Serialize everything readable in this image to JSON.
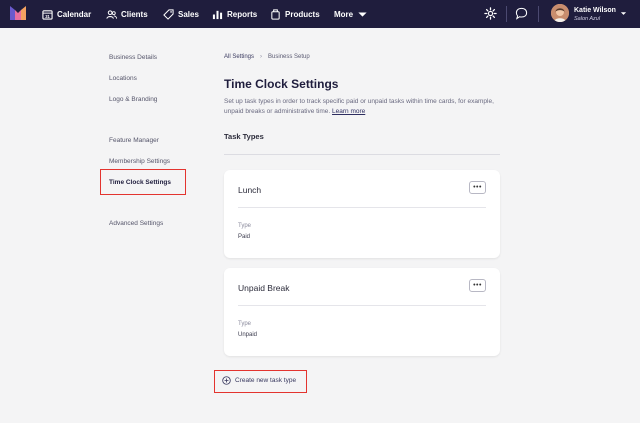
{
  "nav": {
    "items": [
      {
        "label": "Calendar",
        "icon": "calendar-icon"
      },
      {
        "label": "Clients",
        "icon": "clients-icon"
      },
      {
        "label": "Sales",
        "icon": "tag-icon"
      },
      {
        "label": "Reports",
        "icon": "bar-chart-icon"
      },
      {
        "label": "Products",
        "icon": "box-icon"
      },
      {
        "label": "More",
        "icon": "chevron-down-icon"
      }
    ],
    "user": {
      "name": "Katie Wilson",
      "salon": "Salon Azul"
    }
  },
  "sidebar": {
    "items": [
      {
        "label": "Business Details"
      },
      {
        "label": "Locations"
      },
      {
        "label": "Logo & Branding"
      },
      {
        "label": "Feature Manager"
      },
      {
        "label": "Membership Settings"
      },
      {
        "label": "Time Clock Settings",
        "active": true
      },
      {
        "label": "Advanced Settings"
      }
    ]
  },
  "breadcrumb": {
    "root": "All Settings",
    "current": "Business Setup"
  },
  "page": {
    "title": "Time Clock Settings",
    "description": "Set up task types in order to track specific paid or unpaid tasks within time cards, for example, unpaid breaks or administrative time.",
    "learn_more": "Learn more",
    "section_title": "Task Types"
  },
  "task_types": [
    {
      "name": "Lunch",
      "type_label": "Type",
      "type_value": "Paid"
    },
    {
      "name": "Unpaid Break",
      "type_label": "Type",
      "type_value": "Unpaid"
    }
  ],
  "create_button": "Create new task type",
  "colors": {
    "nav_bg": "#1f1d3d",
    "highlight": "#e3342f",
    "page_bg": "#f4f4f5"
  }
}
